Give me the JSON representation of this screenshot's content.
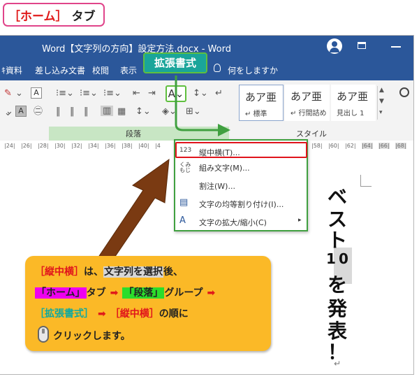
{
  "tab_label": {
    "bracket_text": "［ホーム］",
    "suffix": "タブ"
  },
  "window": {
    "title": "Word【文字列の方向】設定方法.docx  -  Word",
    "tabs": [
      "ｷ資料",
      "差し込み文書",
      "校閲",
      "表示"
    ],
    "tell_me": "何をしますか"
  },
  "ribbon": {
    "kakucho_callout": "拡張書式",
    "kakucho_icon_glyph": "A",
    "paragraph_group_label": "段落",
    "style_group_label": "スタイル",
    "styles": [
      {
        "sample": "あア亜",
        "name": "↵ 標準"
      },
      {
        "sample": "あア亜",
        "name": "↵ 行間詰め"
      },
      {
        "sample": "あア亜",
        "name": "見出し 1"
      }
    ]
  },
  "ruler": [
    "|24|",
    "|26|",
    "|28|",
    "|30|",
    "|32|",
    "|34|",
    "|36|",
    "|38|",
    "|40|",
    "|4",
    "|58|",
    "|60|",
    "|62|",
    "|64|",
    "|66|",
    "|68|"
  ],
  "menu": {
    "items": [
      {
        "icon": "123",
        "label": "縦中横(T)..."
      },
      {
        "icon": "くみ\nもじ",
        "label": "組み文字(M)..."
      },
      {
        "icon": "",
        "label": "割注(W)..."
      },
      {
        "icon": "▤",
        "label": "文字の均等割り付け(I)..."
      },
      {
        "icon": "A",
        "label": "文字の拡大/縮小(C)",
        "has_submenu": true
      }
    ]
  },
  "vertical_text": [
    "ベ",
    "ス",
    "ト",
    "1",
    "0",
    "を",
    "発",
    "表",
    "！",
    "↵"
  ],
  "info": {
    "line1_a": "［縦中横］",
    "line1_b": "は、",
    "line1_c": "文字列を選択",
    "line1_d": "後、",
    "line2_a": "「ホーム」",
    "line2_b": "タブ",
    "line2_arrow": "➡",
    "line2_c": "「段落」",
    "line2_d": "グループ",
    "line2_arrow2": "➡",
    "line3_a": "［拡張書式］",
    "line3_arrow": "➡",
    "line3_b": "［縦中横］",
    "line3_c": "の順に",
    "line4": "クリックします。"
  },
  "colors": {
    "word_blue": "#2b579a",
    "callout_teal": "#1aa59a",
    "green_border": "#40a040",
    "red_highlight": "#e0141c",
    "info_orange": "#fbb927",
    "pointer_brown": "#7a3a12"
  }
}
